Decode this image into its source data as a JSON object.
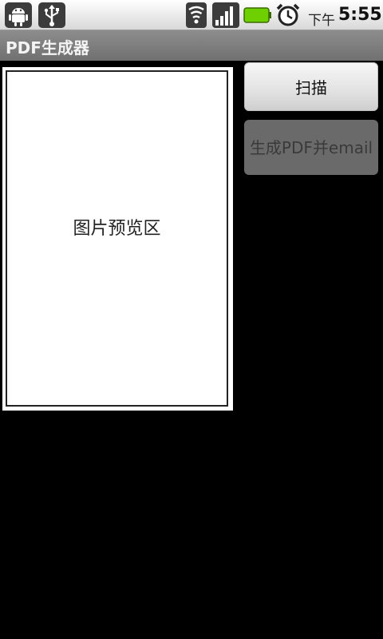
{
  "status_bar": {
    "ampm": "下午",
    "time": "5:55",
    "icons": [
      "android-debug-icon",
      "usb-icon",
      "wifi-icon",
      "signal-icon",
      "battery-icon",
      "alarm-icon"
    ],
    "battery_color": "#6fd000"
  },
  "app": {
    "title": "PDF生成器"
  },
  "preview": {
    "label": "图片预览区"
  },
  "buttons": {
    "scan_label": "扫描",
    "generate_label": "生成PDF并email"
  },
  "colors": {
    "background": "#000000",
    "title_bar": "#7d7d7d",
    "disabled_button": "#6a6a6a"
  }
}
